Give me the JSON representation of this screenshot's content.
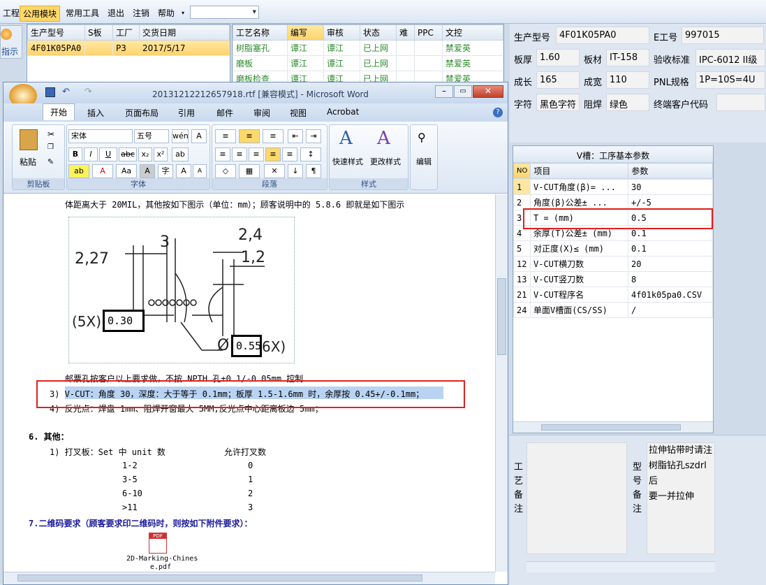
{
  "menubar": {
    "items": [
      "工程",
      "公用模块",
      "常用工具",
      "退出",
      "注销",
      "帮助"
    ],
    "help_arrow": "▾"
  },
  "left_stub": {
    "label": "指示"
  },
  "orders": {
    "columns": [
      "生产型号",
      "S板",
      "工厂",
      "交货日期"
    ],
    "rows": [
      [
        "4F01K05PA0",
        "",
        "P3",
        "2017/5/17"
      ]
    ]
  },
  "process": {
    "columns": [
      "工艺名称",
      "编写",
      "审核",
      "状态",
      "难",
      "PPC",
      "文控"
    ],
    "rows": [
      [
        "树脂塞孔",
        "谭江",
        "谭江",
        "已上网",
        "",
        "",
        "禁爱英"
      ],
      [
        "磨板",
        "谭江",
        "谭江",
        "已上网",
        "",
        "",
        "禁爱英"
      ],
      [
        "磨板检查",
        "谭江",
        "谭江",
        "已上网",
        "",
        "",
        "禁爱英"
      ]
    ]
  },
  "info": {
    "prod_model_label": "生产型号",
    "prod_model": "4F01K05PA0",
    "e_no_label": "E工号",
    "e_no": "997015",
    "thickness_label": "板厚",
    "thickness": "1.60",
    "material_label": "板材",
    "material": "IT-158",
    "standard_label": "验收标准",
    "standard": "IPC-6012 II级",
    "length_label": "成长",
    "length": "165",
    "width_label": "成宽",
    "width": "110",
    "pnl_label": "PNL规格",
    "pnl": "1P=10S=4U",
    "char_label": "字符",
    "char": "黑色字符",
    "mask_label": "阻焊",
    "mask": "绿色",
    "customer_label": "终端客户代码",
    "customer": ""
  },
  "vcut": {
    "title": "V槽：工序基本参数",
    "columns": [
      "NO",
      "项目",
      "参数"
    ],
    "rows": [
      [
        "1",
        "V-CUT角度(β)=  ...",
        "30"
      ],
      [
        "2",
        "角度(β)公差±  ...",
        "+/-5"
      ],
      [
        "3",
        "T =  (mm)",
        "0.5"
      ],
      [
        "4",
        "余厚(T)公差±  (mm)",
        "0.1"
      ],
      [
        "5",
        "对正度(X)≤ (mm)",
        "0.1"
      ],
      [
        "12",
        "V-CUT横刀数",
        "20"
      ],
      [
        "13",
        "V-CUT竖刀数",
        "8"
      ],
      [
        "21",
        "V-CUT程序名",
        "4f01k05pa0.CSV"
      ],
      [
        "24",
        "单面V槽面(CS/SS)",
        "/"
      ]
    ]
  },
  "notes": {
    "craft_label": "工艺备注",
    "model_label": "型号备注",
    "model_text": [
      "拉伸钻带时请注",
      "树脂钻孔szdrl后",
      "要一并拉伸"
    ]
  },
  "word": {
    "title": "20131212212657918.rtf [兼容模式] - Microsoft Word",
    "tabs": [
      "开始",
      "插入",
      "页面布局",
      "引用",
      "邮件",
      "审阅",
      "视图",
      "Acrobat"
    ],
    "font_name": "宋体",
    "font_size": "五号",
    "groups": {
      "clipboard": "剪贴板",
      "font": "字体",
      "paragraph": "段落",
      "styles": "样式",
      "edit": "编辑"
    },
    "paste": "粘贴",
    "quick_style": "快速样式",
    "change_style": "更改样式",
    "edit_btn": "编辑",
    "lines": {
      "l1": "体距离大于 20MIL，其他按如下图示（单位：mm）；顾客说明中的 5.8.6 即就是如下图示",
      "l2": "邮票孔按客户以上要求做，不按 NPTH 孔±0.1/-0.05mm 控制",
      "l3": "3)  V-CUT：角度 30，深度：大于等于 0.1mm；板厚 1.5-1.6mm 时，余厚按 0.45+/-0.1mm；",
      "l4": "4)  反光点：焊盘 1mm、阻焊开窗最大 5MM,反光点中心距离板边 5mm；",
      "sec6": "6.  其他：",
      "sec6a": "1) 打叉板：Set 中 unit 数",
      "allow": "允许打叉数",
      "sec7": "7.二维码要求（顾客要求印二维码时，则按如下附件要求）：",
      "attach1": "2D-Marking-Chines",
      "attach2": "e.pdf"
    },
    "xtable": [
      [
        "1-2",
        "0"
      ],
      [
        "3-5",
        "1"
      ],
      [
        "6-10",
        "2"
      ],
      [
        ">11",
        "3"
      ]
    ],
    "figure": {
      "d1": "2,27",
      "d2": "3",
      "d3": "2,4",
      "d4": "1,2",
      "d5": "(5X)",
      "d6": "0.30",
      "d7": "0.55",
      "d8": "6X)",
      "d9": "Ø"
    }
  }
}
